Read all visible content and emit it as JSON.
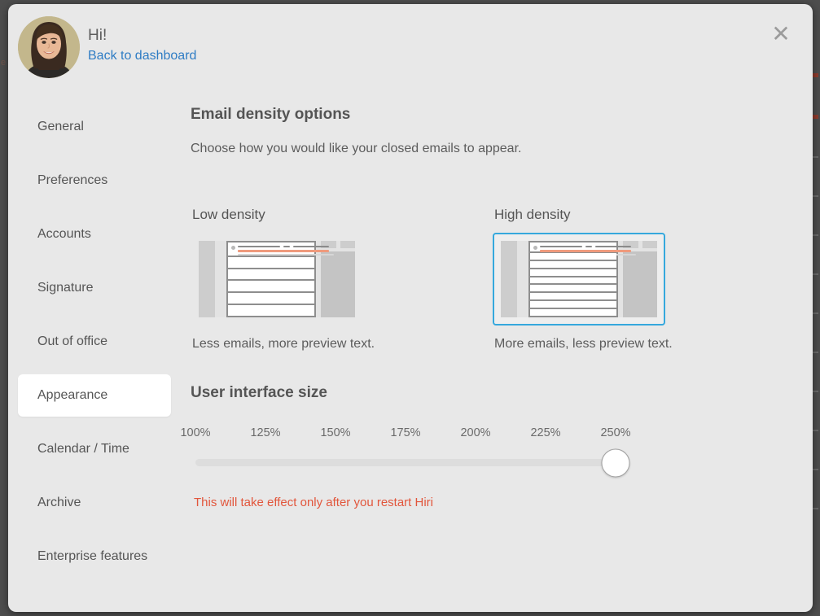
{
  "window": {
    "close_label": "✕"
  },
  "header": {
    "greeting": "Hi!",
    "back_link": "Back to dashboard",
    "avatar_alt": "user-avatar"
  },
  "sidebar": {
    "items": [
      {
        "label": "General",
        "active": false
      },
      {
        "label": "Preferences",
        "active": false
      },
      {
        "label": "Accounts",
        "active": false
      },
      {
        "label": "Signature",
        "active": false
      },
      {
        "label": "Out of office",
        "active": false
      },
      {
        "label": "Appearance",
        "active": true
      },
      {
        "label": "Calendar / Time",
        "active": false
      },
      {
        "label": "Archive",
        "active": false
      },
      {
        "label": "Enterprise features",
        "active": false
      }
    ]
  },
  "main": {
    "density": {
      "title": "Email density options",
      "subtitle": "Choose how you would like your closed emails to appear.",
      "options": [
        {
          "label": "Low density",
          "caption": "Less emails, more preview text.",
          "rows": 6,
          "selected": false
        },
        {
          "label": "High density",
          "caption": "More emails, less preview text.",
          "rows": 9,
          "selected": true
        }
      ]
    },
    "ui_size": {
      "title": "User interface size",
      "ticks": [
        "100%",
        "125%",
        "150%",
        "175%",
        "200%",
        "225%",
        "250%"
      ],
      "selected_value": "250%",
      "selected_index": 6,
      "restart_note": "This will take effect only after you restart Hiri"
    }
  },
  "colors": {
    "accent_selected_border": "#35a8dd",
    "link": "#2e7cc4",
    "warning": "#e2563c",
    "modal_bg": "#e8e8e8",
    "backdrop": "#4d4d4d",
    "text_primary": "#555555",
    "track": "#dddddd"
  }
}
